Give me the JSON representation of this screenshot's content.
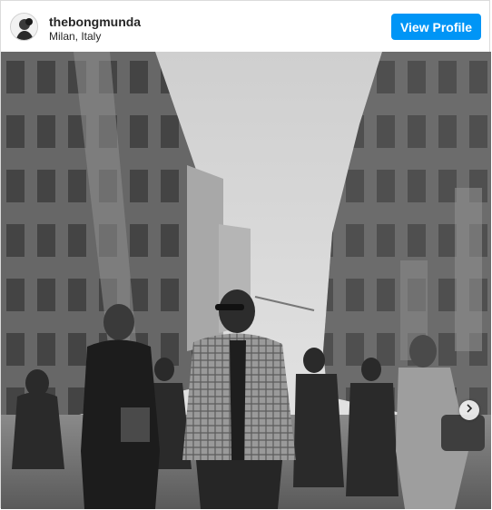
{
  "post": {
    "username": "thebongmunda",
    "location": "Milan, Italy",
    "view_profile_label": "View Profile"
  },
  "icons": {
    "next": "chevron-right-icon",
    "avatar": "avatar"
  },
  "colors": {
    "button": "#0095f6",
    "button_text": "#ffffff",
    "text": "#262626",
    "border": "#dbdbdb"
  }
}
